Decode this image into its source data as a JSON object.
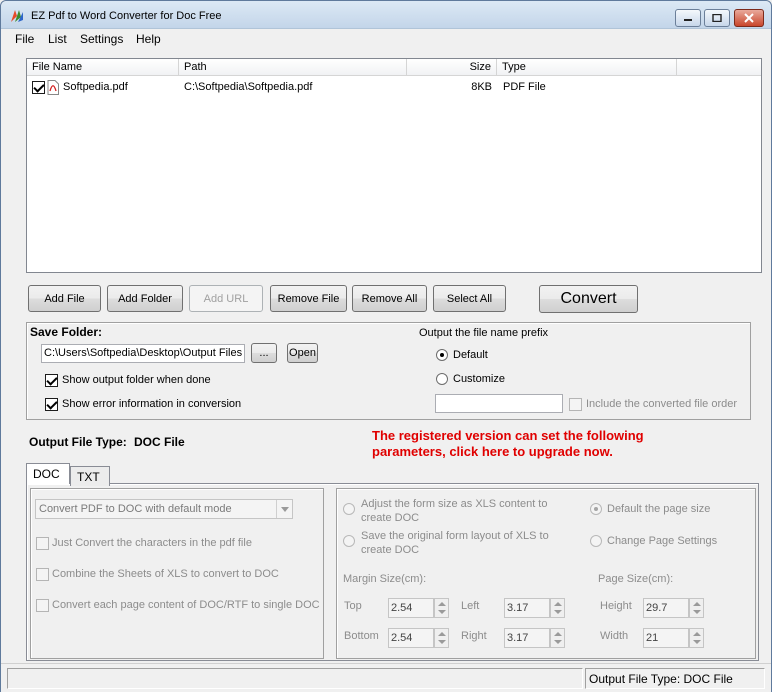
{
  "window": {
    "title": "EZ Pdf to Word Converter for Doc Free"
  },
  "menu": [
    "File",
    "List",
    "Settings",
    "Help"
  ],
  "file_list": {
    "columns": [
      "File Name",
      "Path",
      "Size",
      "Type"
    ],
    "rows": [
      {
        "checked": true,
        "name": "Softpedia.pdf",
        "path": "C:\\Softpedia\\Softpedia.pdf",
        "size": "8KB",
        "type": "PDF File"
      }
    ]
  },
  "buttons": {
    "add_file": "Add File",
    "add_folder": "Add Folder",
    "add_url": "Add URL",
    "remove_file": "Remove File",
    "remove_all": "Remove All",
    "select_all": "Select All",
    "convert": "Convert"
  },
  "save": {
    "label": "Save Folder:",
    "folder_value": "C:\\Users\\Softpedia\\Desktop\\Output Files",
    "browse_label": "...",
    "open_label": "Open",
    "show_output_label": "Show output folder when done",
    "show_output_checked": true,
    "show_error_label": "Show error information in conversion",
    "show_error_checked": true
  },
  "prefix": {
    "label": "Output the file name prefix",
    "default_label": "Default",
    "customize_label": "Customize",
    "selected": "Default",
    "prefix_value": "",
    "include_order_label": "Include the converted file order",
    "include_order_checked": false
  },
  "output_type": {
    "label": "Output File Type:",
    "value": "DOC File"
  },
  "promo": {
    "line1": "The registered version can set the following",
    "line2": "parameters, click here to upgrade now."
  },
  "tabs": [
    "DOC",
    "TXT"
  ],
  "active_tab": "DOC",
  "doc_options": {
    "mode_select": "Convert PDF to DOC with default mode",
    "opt1": "Just Convert the characters in the pdf file",
    "opt2": "Combine the Sheets of XLS to convert to DOC",
    "opt3": "Convert each page content of DOC/RTF to single DOC"
  },
  "layout_options": {
    "adjust_form": "Adjust the form size as XLS content to create DOC",
    "save_form": "Save the original form layout of XLS to create DOC",
    "default_page": "Default the page size",
    "change_page": "Change Page Settings",
    "selected_page": "Default the page size"
  },
  "margins": {
    "label": "Margin Size(cm):",
    "top_label": "Top",
    "top": "2.54",
    "left_label": "Left",
    "left": "3.17",
    "bottom_label": "Bottom",
    "bottom": "2.54",
    "right_label": "Right",
    "right": "3.17"
  },
  "page_size": {
    "label": "Page Size(cm):",
    "height_label": "Height",
    "height": "29.7",
    "width_label": "Width",
    "width": "21"
  },
  "status": {
    "text": "Output File Type:  DOC File"
  },
  "colors": {
    "promo": "#e00000",
    "titlebar": "#c3d5e9"
  }
}
